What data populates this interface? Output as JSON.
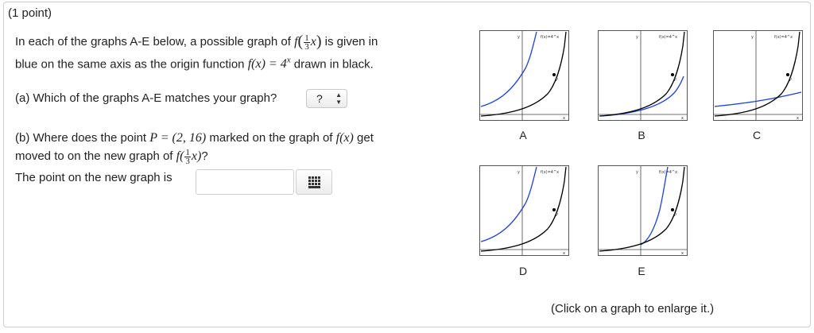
{
  "question": {
    "points": "(1 point)",
    "intro_1": "In each of the graphs A-E below, a possible graph of",
    "intro_func": "f",
    "intro_num": "1",
    "intro_den": "3",
    "intro_var": "x",
    "intro_2": "is given in",
    "intro_3": "blue on the same axis as the origin function",
    "intro_math": "f(x) = 4",
    "intro_exp": "x",
    "intro_4": "drawn in black.",
    "part_a": "(a) Which of the graphs A-E matches your graph?",
    "part_a_select": "?",
    "part_b_1": "(b) Where does the point",
    "part_b_point": "P = (2, 16)",
    "part_b_2": "marked on the graph of",
    "part_b_fx": "f(x)",
    "part_b_3": "get",
    "part_b_4": "moved to on the new graph of",
    "part_b_f": "f(",
    "part_b_num": "1",
    "part_b_den": "3",
    "part_b_x": "x)",
    "part_b_q": "?",
    "answer_label": "The point on the new graph is",
    "answer_value": "",
    "enlarge_hint": "(Click on a graph to enlarge it.)"
  },
  "graphs": [
    {
      "label": "A",
      "blue_curve": "f(3x/... shifted left)",
      "axis_y": "y",
      "axis_x": "x",
      "func_label": "f(x)=4^x",
      "point": "P"
    },
    {
      "label": "B",
      "axis_y": "y",
      "axis_x": "x",
      "func_label": "f(x)=4^x",
      "point": "P"
    },
    {
      "label": "C",
      "axis_y": "y",
      "axis_x": "x",
      "func_label": "f(x)=4^x",
      "point": "P"
    },
    {
      "label": "D",
      "axis_y": "y",
      "axis_x": "x",
      "func_label": "f(x)=4^x",
      "point": "P"
    },
    {
      "label": "E",
      "axis_y": "y",
      "axis_x": "x",
      "func_label": "f(x)=4^x",
      "point": "P"
    }
  ],
  "colors": {
    "original_curve": "#000000",
    "candidate_curve": "#1f3fd6",
    "border": "#cfcfcf"
  },
  "icons": {
    "select_arrows": "up-down-arrows-icon",
    "palette": "grid-icon"
  }
}
